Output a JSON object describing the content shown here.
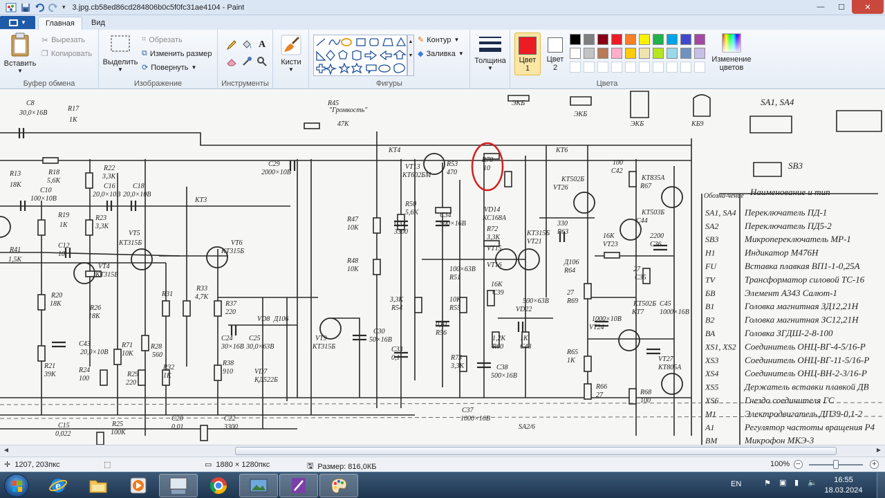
{
  "window": {
    "title": "3.jpg.cb58ed86cd284806b0c5f0fc31ae4104 - Paint",
    "controls": {
      "minimize": "—",
      "maximize": "☐",
      "close": "✕"
    }
  },
  "tabs": [
    {
      "label": "Главная",
      "active": true
    },
    {
      "label": "Вид",
      "active": false
    }
  ],
  "ribbon": {
    "clipboard": {
      "label": "Буфер обмена",
      "paste": "Вставить",
      "cut": "Вырезать",
      "copy": "Копировать"
    },
    "image": {
      "label": "Изображение",
      "select": "Выделить",
      "crop": "Обрезать",
      "resize": "Изменить размер",
      "rotate": "Повернуть"
    },
    "tools": {
      "label": "Инструменты"
    },
    "brushes": {
      "label": "Кисти"
    },
    "shapes": {
      "label": "Фигуры",
      "outline": "Контур",
      "fill": "Заливка"
    },
    "size": {
      "label": "Толщина"
    },
    "colors": {
      "label": "Цвета",
      "color1_label": "Цвет\n1",
      "color1_a": "Цвет",
      "color1_b": "1",
      "color2_a": "Цвет",
      "color2_b": "2",
      "edit_a": "Изменение",
      "edit_b": "цветов",
      "color1": "#ec1c24",
      "color2": "#ffffff",
      "palette_row1": [
        "#000000",
        "#7f7f7f",
        "#880015",
        "#ed1c24",
        "#ff7f27",
        "#fff200",
        "#22b14c",
        "#00a2e8",
        "#3f48cc",
        "#a349a4"
      ],
      "palette_row2": [
        "#ffffff",
        "#c3c3c3",
        "#b97a57",
        "#ffaec9",
        "#ffc90e",
        "#efe4b0",
        "#b5e61d",
        "#99d9ea",
        "#7092be",
        "#c8bfe7"
      ]
    }
  },
  "canvas": {
    "labels": [
      "C8",
      "30,0×16В",
      "R17",
      "1К",
      "R13",
      "18К",
      "R18",
      "5,6К",
      "R22",
      "3,3К",
      "C10",
      "100×10В",
      "C16",
      "20,0×10В",
      "C18",
      "20,0×10В",
      "КТ3",
      "R19",
      "1К",
      "R23",
      "3,3К",
      "VT5",
      "КТ315Б",
      "VT6",
      "КТ315Б",
      "R41",
      "1,5К",
      "C12",
      "10",
      "VT4",
      "КТ315Б",
      "R20",
      "18К",
      "R26",
      "18К",
      "R31",
      "R33",
      "4,7К",
      "R37",
      "220",
      "VD8",
      "Д106",
      "C24",
      "30×16В",
      "C25",
      "30,0×63В",
      "VT9",
      "КТ315Б",
      "C30",
      "50×16В",
      "C33",
      "0,1",
      "R21",
      "39К",
      "C43",
      "20,0×10В",
      "R71",
      "10К",
      "R28",
      "560",
      "R24",
      "100",
      "R29",
      "220",
      "R32",
      "1К",
      "R38",
      "910",
      "VD7",
      "КД522Б",
      "R25",
      "100К",
      "C15",
      "0,022",
      "C20",
      "0,01",
      "C22",
      "3300",
      "\"Громкость\"",
      "R45",
      "47К",
      "C29",
      "2000×10В",
      "КТ4",
      "VT13",
      "КТ602БМ",
      "R53",
      "470",
      "R70",
      "10",
      "КТ6",
      "R47",
      "10К",
      "R48",
      "10К",
      "C31",
      "3300",
      "R50",
      "5,6К",
      "C34",
      "500×16В",
      "VD14",
      "КС168А",
      "R72",
      "3,3К",
      "VT15",
      "VT16",
      "КТ315Б",
      "VT21",
      "КТ502Б",
      "VT26",
      "КТ835А",
      "R67",
      "100",
      "C42",
      "330",
      "R63",
      "16К",
      "VT23",
      "КТ503Б",
      "C44",
      "2200",
      "C36",
      "100×63В",
      "R51",
      "3,3К",
      "R54",
      "10К",
      "R55",
      "16К",
      "C39",
      "500×63В",
      "VD22",
      "Д106",
      "R64",
      "27",
      "R69",
      "27",
      "C35",
      "0,01",
      "R56",
      "1,2К",
      "R60",
      "1К",
      "C43",
      "1000×10В",
      "VT24",
      "КТ502Б",
      "КТ7",
      "C45",
      "1000×16В",
      "R73",
      "3,3К",
      "C38",
      "500×16В",
      "R65",
      "1К",
      "VT27",
      "КТ805А",
      "R66",
      "27",
      "R68",
      "100",
      "C37",
      "1000×16В",
      "SA2/6",
      "ЭКБ",
      "ЭКБ",
      "ЭКБ",
      "КБ9",
      "SA1, SA4",
      "SB3"
    ],
    "table_header": [
      "Обозна-чение",
      "Наименование и тип"
    ],
    "table_rows": [
      [
        "SA1, SA4",
        "Переключатель ПД-1"
      ],
      [
        "SA2",
        "Переключатель ПД5-2"
      ],
      [
        "SB3",
        "Микропереключатель МР-1"
      ],
      [
        "H1",
        "Индикатор М476Н"
      ],
      [
        "FU",
        "Вставка плавкая ВП1-1-0,25А"
      ],
      [
        "TV",
        "Трансформатор силовой ТС-16"
      ],
      [
        "БВ",
        "Элемент А343 Салют-1"
      ],
      [
        "B1",
        "Головка магнитная ЗД12,21Н"
      ],
      [
        "B2",
        "Головка магнитная ЗС12,21Н"
      ],
      [
        "ВА",
        "Головка ЗГДШ-2-8-100"
      ],
      [
        "XS1, XS2",
        "Соединитель ОНЦ-ВГ-4-5/16-Р"
      ],
      [
        "XS3",
        "Соединитель ОНЦ-ВГ-11-5/16-Р"
      ],
      [
        "XS4",
        "Соединитель ОНЦ-ВН-2-3/16-Р"
      ],
      [
        "XS5",
        "Держатель вставки плавкой ДВ"
      ],
      [
        "XS6",
        "Гнездо соединителя ГС"
      ],
      [
        "M1",
        "Электродвигатель ДП39-0,1-2"
      ],
      [
        "A1",
        "Регулятор частоты вращения Р4"
      ],
      [
        "ВМ",
        "Микрофон МКЭ-3"
      ]
    ]
  },
  "statusbar": {
    "cursor": "1207, 203пкс",
    "dimensions": "1880 × 1280пкс",
    "size": "Размер: 816,0КБ",
    "zoom": "100%",
    "zoom_level": 0.5
  },
  "taskbar": {
    "lang": "EN",
    "time": "16:55",
    "date": "18.03.2024"
  }
}
